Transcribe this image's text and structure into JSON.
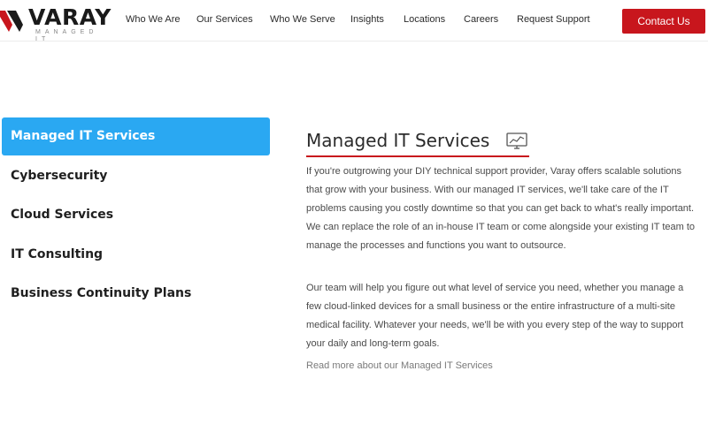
{
  "header": {
    "logo": {
      "wordmark": "VARAY",
      "tagline": "MANAGED IT"
    },
    "nav": [
      {
        "label": "Who We Are"
      },
      {
        "label": "Our Services"
      },
      {
        "label": "Who We Serve"
      },
      {
        "label": "Insights"
      },
      {
        "label": "Locations"
      },
      {
        "label": "Careers"
      },
      {
        "label": "Request Support"
      }
    ],
    "contact_label": "Contact Us"
  },
  "sidebar": {
    "items": [
      {
        "label": "Managed IT Services",
        "active": true
      },
      {
        "label": "Cybersecurity"
      },
      {
        "label": "Cloud Services"
      },
      {
        "label": "IT Consulting"
      },
      {
        "label": "Business Continuity Plans"
      }
    ]
  },
  "main": {
    "title": "Managed IT Services",
    "title_icon": "monitor-chart-icon",
    "paragraphs": [
      "If you're outgrowing your DIY technical support provider, Varay offers scalable solutions that grow with your business. With our managed IT services, we'll take care of the IT problems causing you costly downtime so that you can get back to what's really important. We can replace the role of an in-house IT team or come alongside your existing IT team to manage the processes and functions you want to outsource.",
      "Our team will help you figure out what level of service you need, whether you manage a few cloud-linked devices for a small business or the entire infrastructure of a multi-site medical facility. Whatever your needs, we'll be with you every step of the way to support your daily and long-term goals."
    ],
    "read_more": "Read more about our Managed IT Services"
  },
  "colors": {
    "brand_red": "#c8161d",
    "active_blue": "#2aa8f2",
    "text_dark": "#1f1f1f",
    "text_body": "#4a4a4a"
  }
}
